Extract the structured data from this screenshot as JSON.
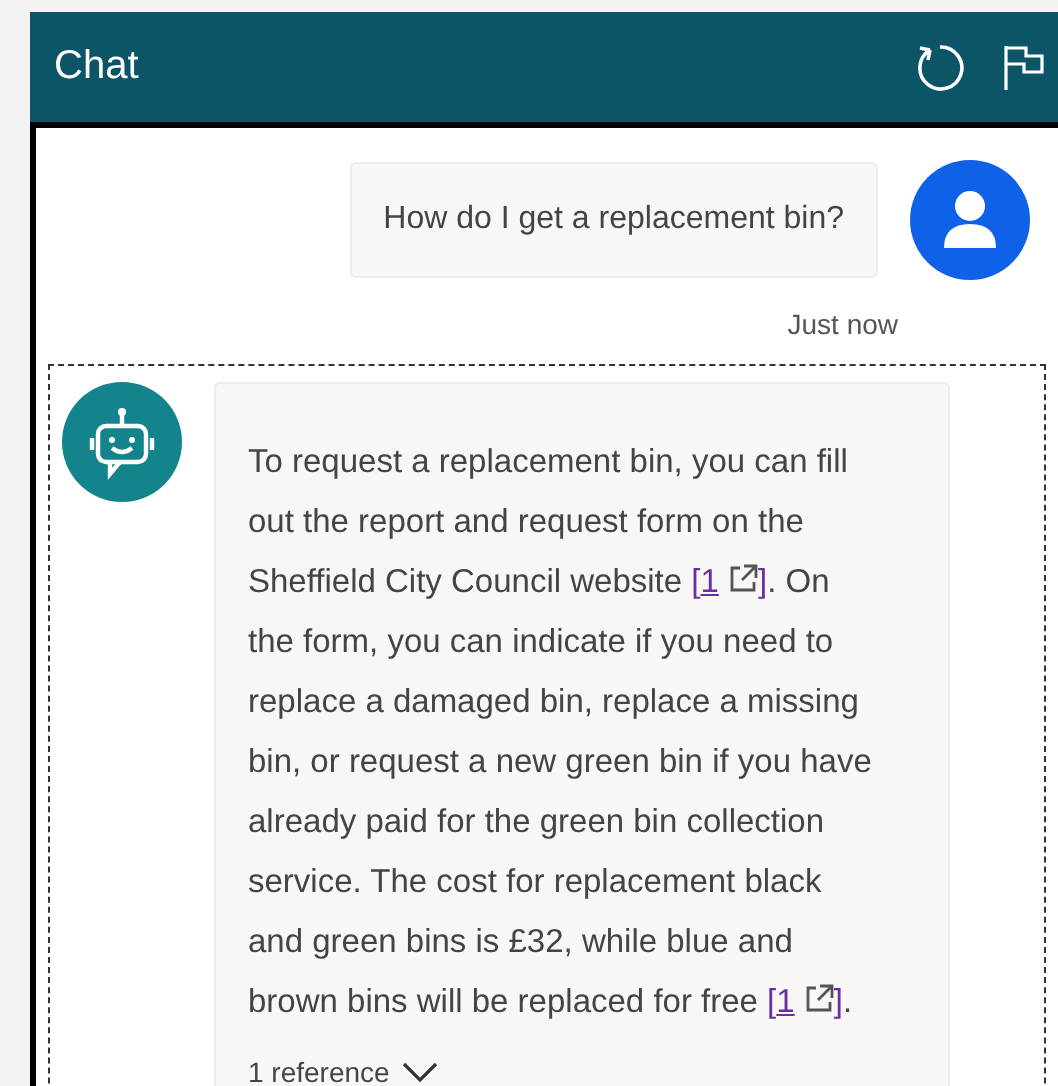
{
  "header": {
    "title": "Chat"
  },
  "user_message": {
    "text": "How do I get a replacement bin?",
    "time": "Just now"
  },
  "bot_message": {
    "parts": [
      {
        "kind": "text",
        "text": "To request a replacement bin, you can fill out the report and request form on the Sheffield City Council website "
      },
      {
        "kind": "citation",
        "open": "[",
        "label": "1",
        "close": "]"
      },
      {
        "kind": "text",
        "text": ". On the form, you can indicate if you need to replace a damaged bin, replace a missing bin, or request a new green bin if you have already paid for the green bin collection service. The cost for replacement black and green bins is £32, while blue and brown bins will be replaced for free "
      },
      {
        "kind": "citation",
        "open": "[",
        "label": "1",
        "close": "]"
      },
      {
        "kind": "text",
        "text": "."
      }
    ],
    "references": "1 reference"
  }
}
